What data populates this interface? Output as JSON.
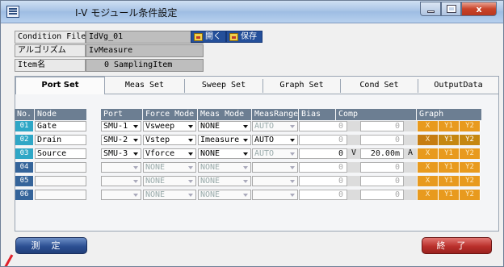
{
  "window": {
    "title": "I-V モジュール条件設定",
    "close_glyph": "x"
  },
  "info": {
    "condition_file_label": "Condition File",
    "condition_file_value": "IdVg_01",
    "algorithm_label": "アルゴリズム",
    "algorithm_value": "IvMeasure",
    "item_label": "Item名",
    "item_value": "0 SamplingItem"
  },
  "file_buttons": {
    "open_label": "開く",
    "save_label": "保存"
  },
  "tabs": [
    {
      "label": "Port Set",
      "active": true
    },
    {
      "label": "Meas Set",
      "active": false
    },
    {
      "label": "Sweep Set",
      "active": false
    },
    {
      "label": "Graph Set",
      "active": false
    },
    {
      "label": "Cond Set",
      "active": false
    },
    {
      "label": "OutputData",
      "active": false
    }
  ],
  "table": {
    "headers": {
      "no": "No.",
      "node": "Node",
      "port": "Port",
      "force_mode": "Force Mode",
      "meas_mode": "Meas Mode",
      "meas_range": "MeasRange",
      "bias": "Bias",
      "comp": "Comp",
      "graph": "Graph"
    },
    "rows": [
      {
        "no": "01",
        "node": "Gate",
        "port": "SMU-1",
        "force_mode": "Vsweep",
        "meas_mode": "NONE",
        "meas_range": "AUTO",
        "bias": "0",
        "bias_unit": "",
        "comp": "0",
        "comp_unit": "",
        "x": "X",
        "y1": "Y1",
        "y2": "Y2"
      },
      {
        "no": "02",
        "node": "Drain",
        "port": "SMU-2",
        "force_mode": "Vstep",
        "meas_mode": "Imeasure",
        "meas_range": "AUTO",
        "bias": "0",
        "bias_unit": "",
        "comp": "0",
        "comp_unit": "",
        "x": "X",
        "y1": "Y1",
        "y2": "Y2"
      },
      {
        "no": "03",
        "node": "Source",
        "port": "SMU-3",
        "force_mode": "Vforce",
        "meas_mode": "NONE",
        "meas_range": "AUTO",
        "bias": "0",
        "bias_unit": "V",
        "comp": "20.00m",
        "comp_unit": "A",
        "x": "X",
        "y1": "Y1",
        "y2": "Y2"
      },
      {
        "no": "04",
        "node": "",
        "port": "",
        "force_mode": "NONE",
        "meas_mode": "NONE",
        "meas_range": "",
        "bias": "0",
        "bias_unit": "",
        "comp": "0",
        "comp_unit": "",
        "x": "X",
        "y1": "Y1",
        "y2": "Y2"
      },
      {
        "no": "05",
        "node": "",
        "port": "",
        "force_mode": "NONE",
        "meas_mode": "NONE",
        "meas_range": "",
        "bias": "0",
        "bias_unit": "",
        "comp": "0",
        "comp_unit": "",
        "x": "X",
        "y1": "Y1",
        "y2": "Y2"
      },
      {
        "no": "06",
        "node": "",
        "port": "",
        "force_mode": "NONE",
        "meas_mode": "NONE",
        "meas_range": "",
        "bias": "0",
        "bias_unit": "",
        "comp": "0",
        "comp_unit": "",
        "x": "X",
        "y1": "Y1",
        "y2": "Y2"
      }
    ]
  },
  "footer": {
    "measure_label": "測定",
    "exit_label": "終了"
  },
  "colors": {
    "graph_button": "#e89a1e",
    "graph_button_selected": "#c58711",
    "row_number_active": "#2fa7c6",
    "row_number_inactive": "#35649a",
    "header": "#6c7e92",
    "measure_button": "#2c4f92",
    "exit_button": "#b9302b"
  }
}
